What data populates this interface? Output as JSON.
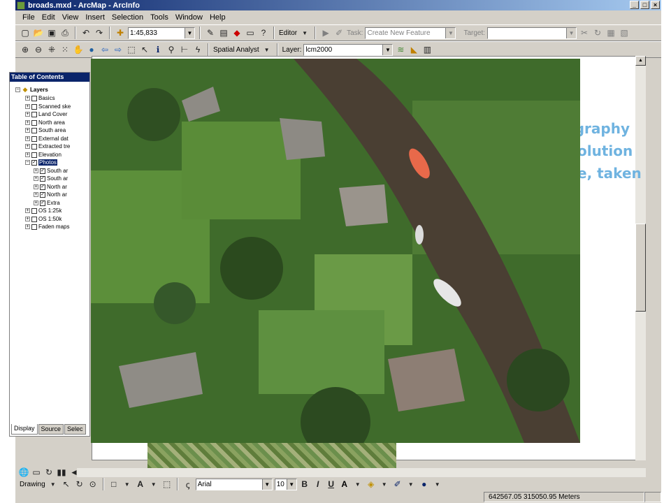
{
  "window": {
    "title": "broads.mxd - ArcMap - ArcInfo"
  },
  "menu": [
    "File",
    "Edit",
    "View",
    "Insert",
    "Selection",
    "Tools",
    "Window",
    "Help"
  ],
  "toolbar1": {
    "scale": "1:45,833",
    "editor_label": "Editor",
    "task_label": "Task:",
    "task_value": "Create New Feature",
    "target_label": "Target:"
  },
  "toolbar2": {
    "spatial_analyst_label": "Spatial Analyst",
    "layer_label": "Layer:",
    "layer_value": "lcm2000"
  },
  "toc": {
    "title": "Table of Contents",
    "root": "Layers",
    "layers": [
      {
        "name": "Basics",
        "checked": false
      },
      {
        "name": "Scanned ske",
        "checked": false
      },
      {
        "name": "Land Cover",
        "checked": false
      },
      {
        "name": "North area",
        "checked": false
      },
      {
        "name": "South area",
        "checked": false
      },
      {
        "name": "External dat",
        "checked": false
      },
      {
        "name": "Extracted tre",
        "checked": false
      },
      {
        "name": "Elevation",
        "checked": false
      },
      {
        "name": "Photos",
        "checked": true
      },
      {
        "name": "South ar",
        "checked": true
      },
      {
        "name": "South ar",
        "checked": true
      },
      {
        "name": "North ar",
        "checked": true
      },
      {
        "name": "North ar",
        "checked": true
      },
      {
        "name": "Extra",
        "checked": true
      },
      {
        "name": "OS 1:25k",
        "checked": false
      },
      {
        "name": "OS 1:50k",
        "checked": false
      },
      {
        "name": "Faden maps",
        "checked": false
      }
    ],
    "tabs": [
      "Display",
      "Source",
      "Selec"
    ]
  },
  "overlay_text": [
    "ography",
    "olution",
    "e, taken"
  ],
  "drawing_toolbar": {
    "drawing_label": "Drawing",
    "font_name": "Arial",
    "font_size": "10",
    "bold": "B",
    "italic": "I",
    "underline": "U"
  },
  "status": {
    "coordinates": "642567.05  315050.95 Meters"
  }
}
